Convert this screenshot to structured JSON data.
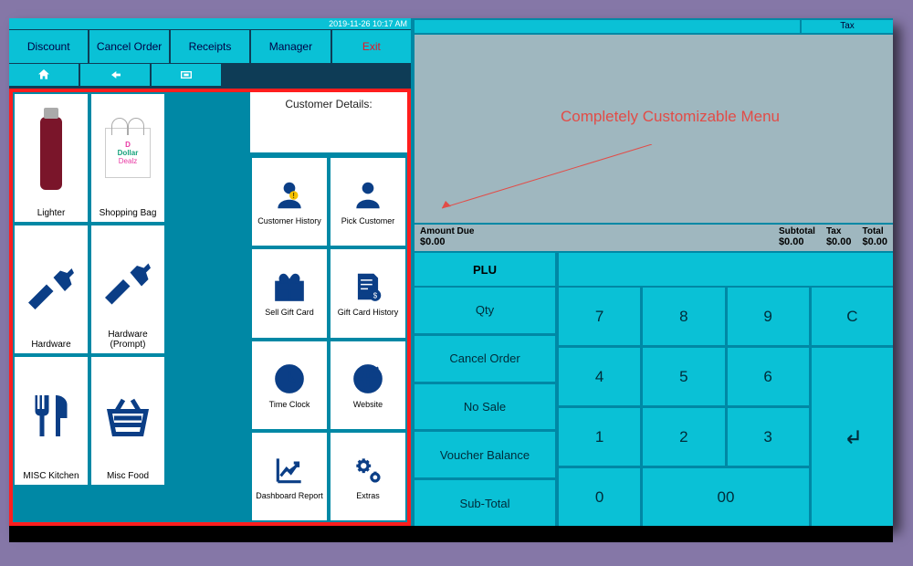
{
  "clock": "2019-11-26 10:17 AM",
  "topButtons": {
    "discount": "Discount",
    "cancelOrder": "Cancel Order",
    "receipts": "Receipts",
    "manager": "Manager",
    "exit": "Exit"
  },
  "productTiles": {
    "row1": {
      "a": "Lighter",
      "b": "Shopping Bag"
    },
    "row2": {
      "a": "Hardware",
      "b": "Hardware (Prompt)"
    },
    "row3": {
      "a": "MISC Kitchen",
      "b": "Misc Food"
    }
  },
  "bagBrand": {
    "line1": "Dollar",
    "line2": "Dealz",
    "logo": "D"
  },
  "customer": {
    "header": "Customer Details:",
    "items": [
      "Customer History",
      "Pick Customer",
      "Sell Gift Card",
      "Gift Card History",
      "Time Clock",
      "Website",
      "Dashboard Report",
      "Extras"
    ]
  },
  "orderHeader": {
    "taxLabel": "Tax"
  },
  "callout": "Completely Customizable Menu",
  "totals": {
    "amountDueLabel": "Amount Due",
    "amountDue": "$0.00",
    "subtotalLabel": "Subtotal",
    "subtotal": "$0.00",
    "taxLabel": "Tax",
    "tax": "$0.00",
    "totalLabel": "Total",
    "total": "$0.00"
  },
  "pluLabel": "PLU",
  "funcKeys": [
    "Qty",
    "Cancel Order",
    "No Sale",
    "Voucher Balance",
    "Sub-Total"
  ],
  "keypad": {
    "k7": "7",
    "k8": "8",
    "k9": "9",
    "kC": "C",
    "k4": "4",
    "k5": "5",
    "k6": "6",
    "k1": "1",
    "k2": "2",
    "k3": "3",
    "k0": "0",
    "k00": "00"
  }
}
